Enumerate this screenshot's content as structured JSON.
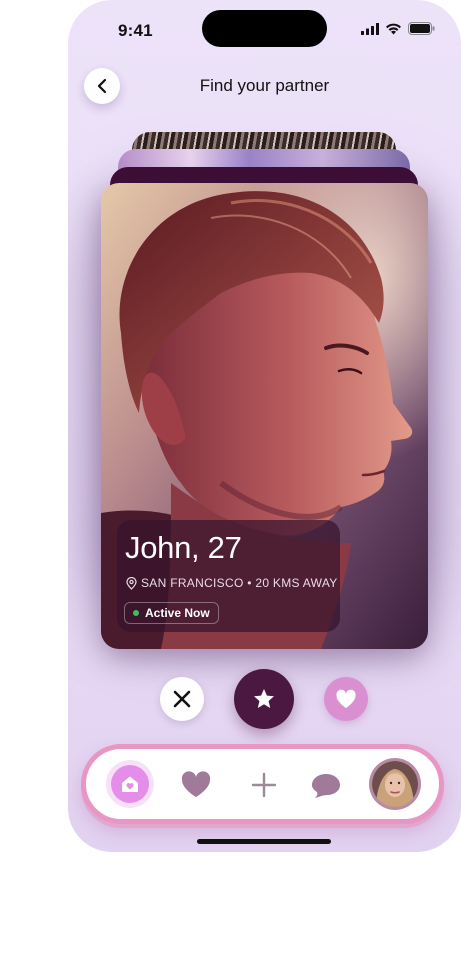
{
  "status_bar": {
    "time": "9:41"
  },
  "header": {
    "title": "Find your partner"
  },
  "profile": {
    "name_age": "John, 27",
    "location": "SAN FRANCISCO • 20 KMS AWAY",
    "status": "Active Now"
  },
  "actions": {
    "dislike_icon": "close-icon",
    "superlike_icon": "star-icon",
    "like_icon": "heart-icon"
  },
  "tabbar": {
    "items": [
      {
        "icon": "home-icon",
        "active": true
      },
      {
        "icon": "heart-icon",
        "active": false
      },
      {
        "icon": "plus-icon",
        "active": false
      },
      {
        "icon": "chat-icon",
        "active": false
      },
      {
        "icon": "avatar",
        "active": false
      }
    ]
  },
  "colors": {
    "background": "#ece2f8",
    "accent_dark": "#4a1840",
    "accent_pink": "#d98fd0",
    "tab_border": "#e896c4",
    "tab_active": "#e58ee9",
    "online": "#3cc05a"
  }
}
